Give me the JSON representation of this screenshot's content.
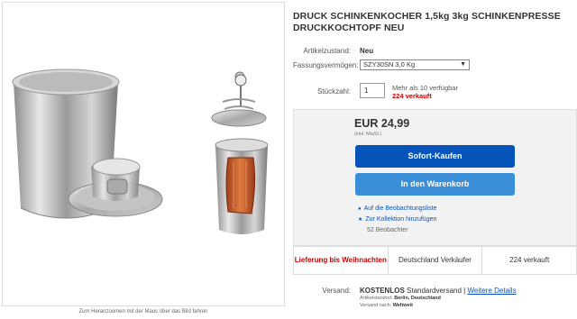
{
  "gallery": {
    "zoom_hint": "Zum Heranzoomen mit der Maus über das Bild fahren"
  },
  "title": "DRUCK SCHINKENKOCHER 1,5kg 3kg SCHINKENPRESSE DRUCKKOCHTOPF NEU",
  "condition": {
    "label": "Artikelzustand:",
    "value": "Neu"
  },
  "capacity": {
    "label": "Fassungsvermögen:",
    "selected": "SZY30SN 3,0 Kg"
  },
  "quantity": {
    "label": "Stückzahl:",
    "value": "1",
    "available": "Mehr als 10 verfügbar",
    "sold": "224 verkauft"
  },
  "price": {
    "amount": "EUR 24,99",
    "vat": "(inkl. MwSt.)"
  },
  "buttons": {
    "buy_now": "Sofort-Kaufen",
    "add_to_cart": "In den Warenkorb"
  },
  "links": {
    "watchlist": "Auf die Beobachtungsliste",
    "collection": "Zur Kollektion hinzufügen"
  },
  "watchers": "52 Beobachter",
  "stats": {
    "delivery": "Lieferung bis Weihnachten",
    "seller": "Deutschland Verkäufer",
    "sold": "224 verkauft"
  },
  "shipping": {
    "label": "Versand:",
    "free": "KOSTENLOS",
    "method": "Standardversand",
    "details_link": "Weitere Details",
    "location_label": "Artikelstandort:",
    "location": "Berlin, Deutschland",
    "ships_to_label": "Versand nach:",
    "ships_to": "Weltweit"
  },
  "colors": {
    "buy": "#0654ba",
    "cart": "#3b8fd8",
    "alert": "#cc0000"
  }
}
